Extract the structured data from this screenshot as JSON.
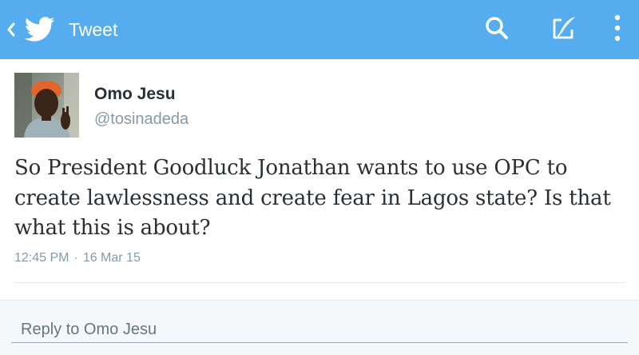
{
  "app": {
    "title": "Tweet",
    "accent": "#55acee",
    "icons": [
      "chevron-left-icon",
      "twitter-bird-icon",
      "search-icon",
      "compose-icon",
      "overflow-menu-icon"
    ]
  },
  "tweet": {
    "author_name": "Omo Jesu",
    "author_handle": "@tosinadeda",
    "text": "So President Goodluck Jonathan wants to use OPC to create lawlessness and create fear in Lagos state? Is that what this is about?",
    "time": "12:45 PM",
    "separator": "·",
    "date": "16 Mar 15"
  },
  "reply": {
    "placeholder": "Reply to Omo Jesu"
  }
}
